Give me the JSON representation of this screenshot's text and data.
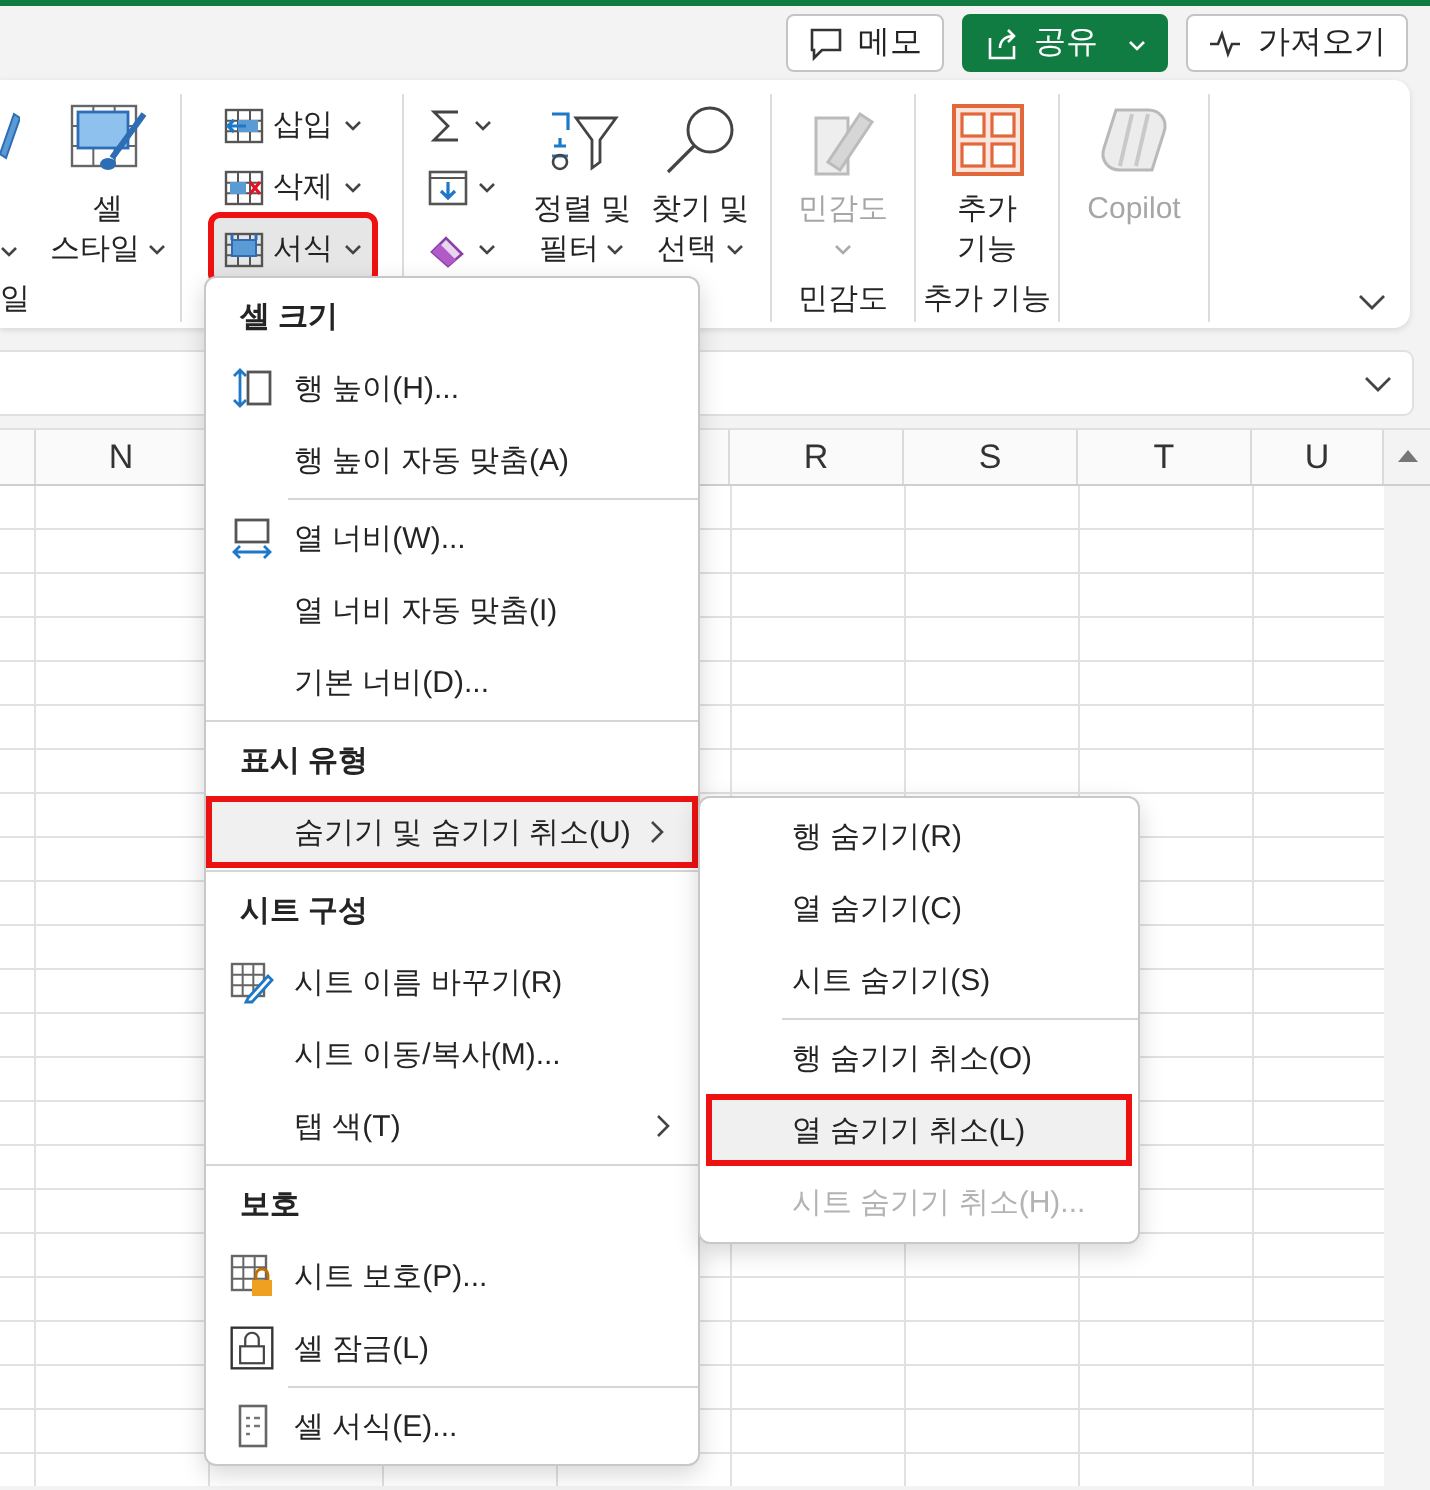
{
  "title_bar": {
    "actions": [
      {
        "kind": "comment",
        "label": "메모",
        "primary": false,
        "dropdown": false
      },
      {
        "kind": "share",
        "label": "공유",
        "primary": true,
        "dropdown": true
      },
      {
        "kind": "activity",
        "label": "가져오기",
        "primary": false,
        "dropdown": false
      }
    ]
  },
  "ribbon": {
    "groups": [
      {
        "label": "일",
        "buttons": [
          {
            "kind": "cut",
            "dropdown": true,
            "disabled": false,
            "selected": false,
            "highlighted": false
          },
          {
            "kind": "large",
            "lines": [
              "셀",
              "스타일"
            ],
            "dropdown": true,
            "disabled": false,
            "selected": false,
            "highlighted": false
          }
        ]
      },
      {
        "buttons": [
          {
            "kind": "small",
            "label": "삽입",
            "dropdown": true,
            "disabled": false,
            "selected": false,
            "highlighted": false
          },
          {
            "kind": "small",
            "label": "삭제",
            "dropdown": true,
            "disabled": false,
            "selected": false,
            "highlighted": false
          },
          {
            "kind": "small",
            "label": "서식",
            "dropdown": true,
            "disabled": false,
            "selected": true,
            "highlighted": true
          }
        ]
      },
      {
        "buttons": [
          {
            "kind": "small",
            "dropdown": true,
            "disabled": false,
            "selected": false,
            "highlighted": false
          },
          {
            "kind": "small",
            "dropdown": true,
            "disabled": false,
            "selected": false,
            "highlighted": false
          },
          {
            "kind": "small",
            "dropdown": true,
            "disabled": false,
            "selected": false,
            "highlighted": false
          },
          {
            "kind": "large",
            "lines": [
              "정렬 및",
              "필터"
            ],
            "dropdown": true,
            "disabled": false,
            "selected": false,
            "highlighted": false
          },
          {
            "kind": "large",
            "lines": [
              "찾기 및",
              "선택"
            ],
            "dropdown": true,
            "disabled": false,
            "selected": false,
            "highlighted": false
          }
        ]
      },
      {
        "label": "민감도",
        "buttons": [
          {
            "kind": "large",
            "lines": [
              "민감도"
            ],
            "dropdown": true,
            "disabled": true,
            "selected": false,
            "highlighted": false
          }
        ]
      },
      {
        "label": "추가 기능",
        "buttons": [
          {
            "kind": "large",
            "lines": [
              "추가",
              "기능"
            ],
            "dropdown": false,
            "disabled": false,
            "selected": false,
            "highlighted": false
          }
        ]
      },
      {
        "buttons": [
          {
            "kind": "large",
            "lines": [
              "Copilot"
            ],
            "dropdown": false,
            "disabled": true,
            "selected": false,
            "highlighted": false
          }
        ]
      }
    ]
  },
  "sheet": {
    "columns": [
      {
        "label": "N"
      },
      {
        "label": "R"
      },
      {
        "label": "S"
      },
      {
        "label": "T"
      },
      {
        "label": "U"
      }
    ]
  },
  "format_menu": {
    "sections": [
      {
        "header": "셀 크기",
        "groups": [
          [
            {
              "label": "행 높이(H)...",
              "submenu": false,
              "selected": false,
              "highlighted": false
            },
            {
              "label": "행 높이 자동 맞춤(A)",
              "submenu": false,
              "selected": false,
              "highlighted": false
            }
          ],
          [
            {
              "label": "열 너비(W)...",
              "submenu": false,
              "selected": false,
              "highlighted": false
            },
            {
              "label": "열 너비 자동 맞춤(I)",
              "submenu": false,
              "selected": false,
              "highlighted": false
            },
            {
              "label": "기본 너비(D)...",
              "submenu": false,
              "selected": false,
              "highlighted": false
            }
          ]
        ]
      },
      {
        "header": "표시 유형",
        "groups": [
          [
            {
              "label": "숨기기 및 숨기기 취소(U)",
              "submenu": true,
              "selected": true,
              "highlighted": true
            }
          ]
        ]
      },
      {
        "header": "시트 구성",
        "groups": [
          [
            {
              "label": "시트 이름 바꾸기(R)",
              "submenu": false,
              "selected": false,
              "highlighted": false
            },
            {
              "label": "시트 이동/복사(M)...",
              "submenu": false,
              "selected": false,
              "highlighted": false
            },
            {
              "label": "탭 색(T)",
              "submenu": true,
              "selected": false,
              "highlighted": false
            }
          ]
        ]
      },
      {
        "header": "보호",
        "groups": [
          [
            {
              "label": "시트 보호(P)...",
              "submenu": false,
              "selected": false,
              "highlighted": false
            },
            {
              "label": "셀 잠금(L)",
              "submenu": false,
              "selected": false,
              "highlighted": false
            }
          ],
          [
            {
              "label": "셀 서식(E)...",
              "submenu": false,
              "selected": false,
              "highlighted": false
            }
          ]
        ]
      }
    ]
  },
  "hide_submenu": {
    "groups": [
      [
        {
          "label": "행 숨기기(R)",
          "selected": false,
          "highlighted": false,
          "disabled": false
        },
        {
          "label": "열 숨기기(C)",
          "selected": false,
          "highlighted": false,
          "disabled": false
        },
        {
          "label": "시트 숨기기(S)",
          "selected": false,
          "highlighted": false,
          "disabled": false
        }
      ],
      [
        {
          "label": "행 숨기기 취소(O)",
          "selected": false,
          "highlighted": false,
          "disabled": false
        },
        {
          "label": "열 숨기기 취소(L)",
          "selected": true,
          "highlighted": true,
          "disabled": false
        },
        {
          "label": "시트 숨기기 취소(H)...",
          "selected": false,
          "highlighted": false,
          "disabled": true
        }
      ]
    ]
  }
}
